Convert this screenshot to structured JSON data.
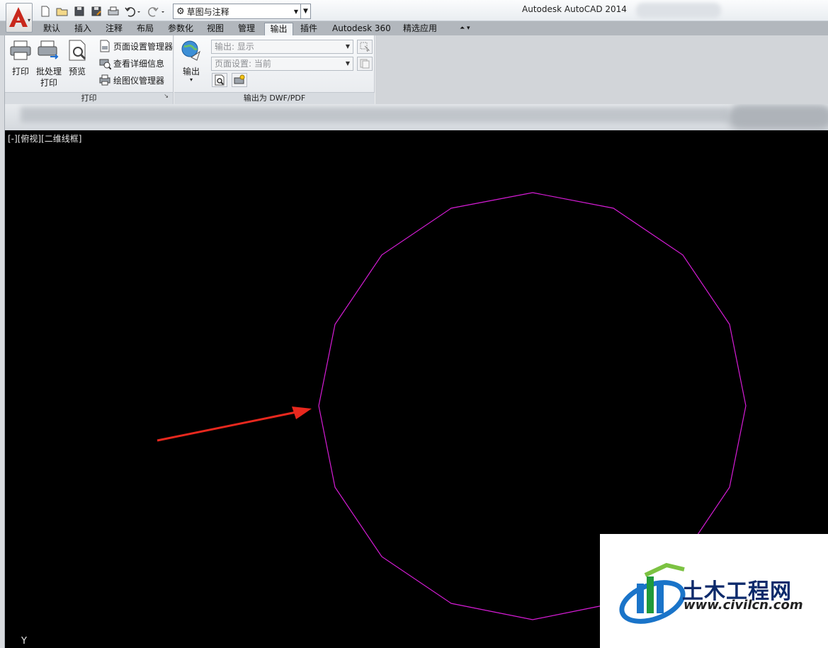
{
  "title_bar": {
    "app_title": "Autodesk AutoCAD 2014",
    "workspace": "草图与注释"
  },
  "quick_access": [
    "new-icon",
    "open-icon",
    "save-icon",
    "save-as-icon",
    "plot-icon",
    "undo-icon",
    "redo-icon"
  ],
  "tabs": [
    {
      "label": "默认"
    },
    {
      "label": "插入"
    },
    {
      "label": "注释"
    },
    {
      "label": "布局"
    },
    {
      "label": "参数化"
    },
    {
      "label": "视图"
    },
    {
      "label": "管理"
    },
    {
      "label": "输出",
      "active": true
    },
    {
      "label": "插件"
    },
    {
      "label": "Autodesk 360"
    },
    {
      "label": "精选应用"
    }
  ],
  "ribbon": {
    "print_panel": {
      "label": "打印",
      "plot_button": "打印",
      "batch_plot_line1": "批处理",
      "batch_plot_line2": "打印",
      "preview_button": "预览",
      "page_setup_manager": "页面设置管理器",
      "view_details": "查看详细信息",
      "plotter_manager": "绘图仪管理器"
    },
    "export_panel": {
      "label": "输出为 DWF/PDF",
      "export_button": "输出",
      "export_combo": "输出: 显示",
      "page_setup_combo": "页面设置: 当前"
    }
  },
  "canvas": {
    "viewport_label": "[-][俯视][二维线框]",
    "ucs_axis_label": "Y",
    "background": "#000000",
    "polygon_color": "#d61cd6",
    "polygon_sides": 16,
    "arrow_color": "#e8281e"
  },
  "watermark": {
    "name": "土木工程网",
    "url": "www.civilcn.com"
  },
  "colors": {
    "accent_red": "#c8281c",
    "ribbon_bg": "#ecedef"
  }
}
